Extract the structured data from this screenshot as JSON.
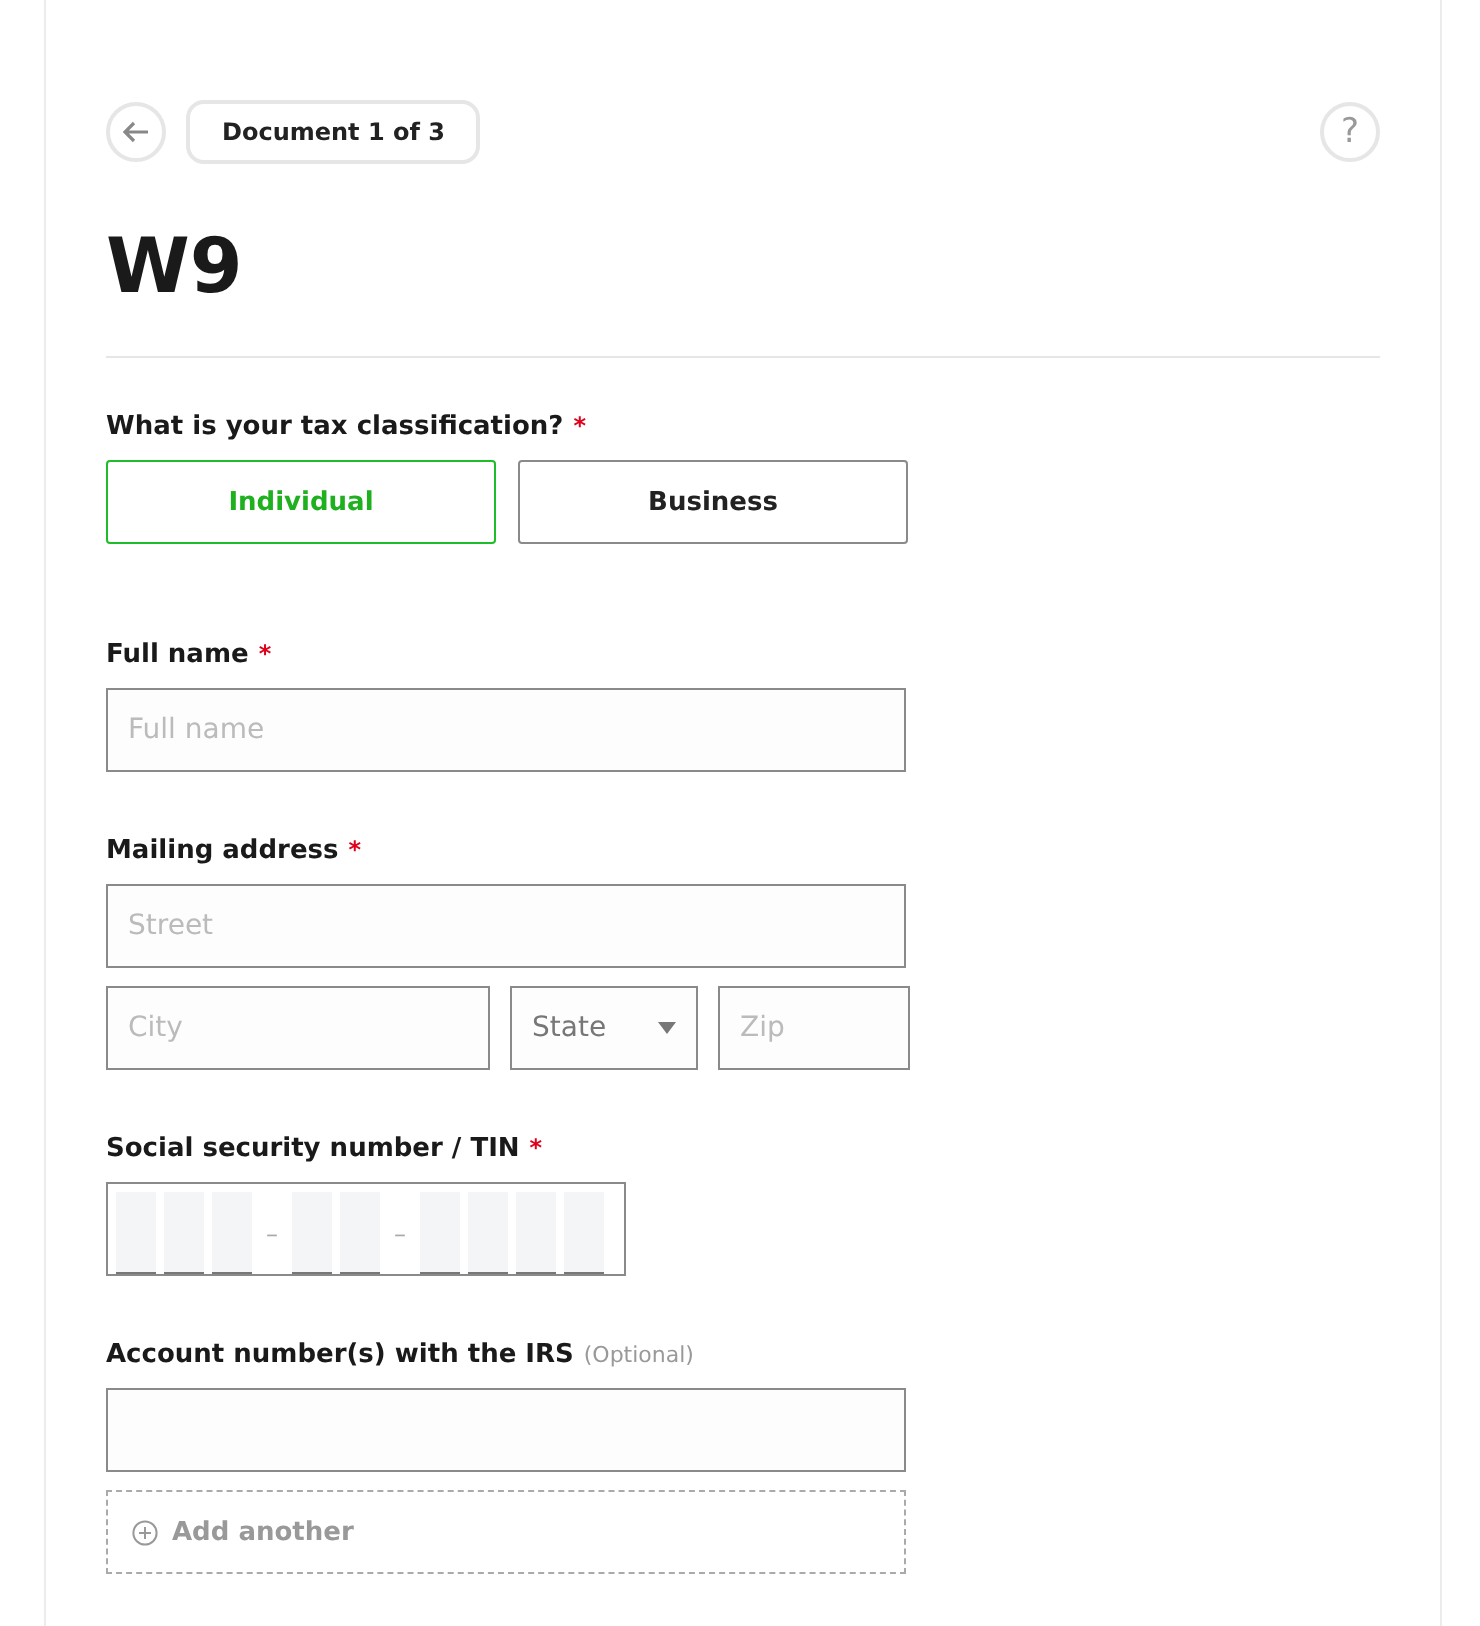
{
  "header": {
    "document_badge": "Document 1 of 3",
    "help_button": "?"
  },
  "title": "W9",
  "classification": {
    "label": "What is your tax classification?",
    "asterisk": "*",
    "options": [
      {
        "label": "Individual",
        "selected": true
      },
      {
        "label": "Business",
        "selected": false
      }
    ]
  },
  "full_name": {
    "label": "Full name",
    "asterisk": "*",
    "placeholder": "Full name"
  },
  "mailing_address": {
    "label": "Mailing address",
    "asterisk": "*",
    "street": {
      "placeholder": "Street"
    },
    "city": {
      "placeholder": "City"
    },
    "state": {
      "value": "State"
    },
    "zip": {
      "placeholder": "Zip"
    }
  },
  "ssn": {
    "label": "Social security number / TIN",
    "asterisk": "*",
    "items": [
      {
        "kind": "digit"
      },
      {
        "kind": "digit"
      },
      {
        "kind": "digit"
      },
      {
        "kind": "dash",
        "text": "–"
      },
      {
        "kind": "digit"
      },
      {
        "kind": "digit"
      },
      {
        "kind": "dash",
        "text": "–"
      },
      {
        "kind": "digit"
      },
      {
        "kind": "digit"
      },
      {
        "kind": "digit"
      },
      {
        "kind": "digit"
      }
    ]
  },
  "account_numbers": {
    "label": "Account number(s) with the IRS",
    "note": "(Optional)",
    "add_button": "Add another"
  }
}
